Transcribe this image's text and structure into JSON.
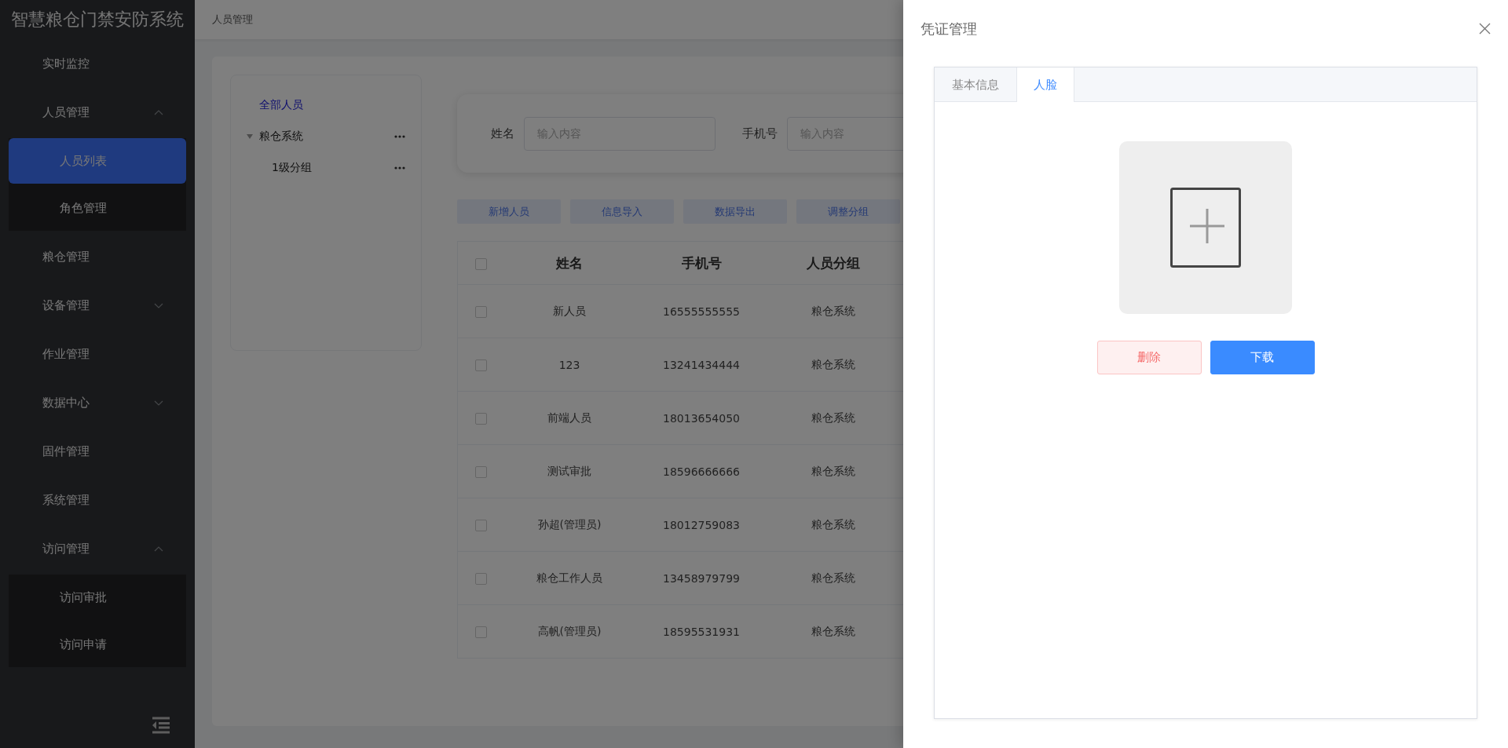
{
  "app_title": "智慧粮仓门禁安防系统",
  "menu": [
    {
      "label": "实时监控"
    },
    {
      "label": "人员管理",
      "expanded": true,
      "children": [
        {
          "label": "人员列表",
          "selected": true
        },
        {
          "label": "角色管理",
          "selected": false
        }
      ]
    },
    {
      "label": "粮仓管理"
    },
    {
      "label": "设备管理",
      "expanded": false
    },
    {
      "label": "作业管理"
    },
    {
      "label": "数据中心",
      "expanded": false
    },
    {
      "label": "固件管理"
    },
    {
      "label": "系统管理"
    },
    {
      "label": "访问管理",
      "expanded": true,
      "children": [
        {
          "label": "访问审批",
          "selected": false
        },
        {
          "label": "访问申请",
          "selected": false
        }
      ]
    }
  ],
  "breadcrumb": "人员管理",
  "tree": [
    {
      "label": "全部人员",
      "selected": true
    },
    {
      "label": "粮仓系统",
      "selected": false,
      "expanded": true,
      "children": [
        {
          "label": "1级分组",
          "selected": false
        }
      ]
    }
  ],
  "search": [
    {
      "label": "姓名",
      "placeholder": "输入内容"
    },
    {
      "label": "手机号",
      "placeholder": "输入内容"
    }
  ],
  "actions": [
    "新增人员",
    "信息导入",
    "数据导出",
    "调整分组"
  ],
  "table": {
    "columns": [
      "姓名",
      "手机号",
      "人员分组"
    ],
    "all_checked": false,
    "rows": [
      {
        "checked": false,
        "cells": [
          "新人员",
          "16555555555",
          "粮仓系统"
        ]
      },
      {
        "checked": false,
        "cells": [
          "123",
          "13241434444",
          "粮仓系统"
        ]
      },
      {
        "checked": false,
        "cells": [
          "前端人员",
          "18013654050",
          "粮仓系统"
        ]
      },
      {
        "checked": false,
        "cells": [
          "测试审批",
          "18596666666",
          "粮仓系统"
        ]
      },
      {
        "checked": false,
        "cells": [
          "孙超(管理员)",
          "18012759083",
          "粮仓系统"
        ]
      },
      {
        "checked": false,
        "cells": [
          "粮仓工作人员",
          "13458979799",
          "粮仓系统"
        ]
      },
      {
        "checked": false,
        "cells": [
          "高帆(管理员)",
          "18595531931",
          "粮仓系统"
        ]
      }
    ]
  },
  "drawer": {
    "title": "凭证管理",
    "tabs": [
      {
        "label": "基本信息",
        "selected": false
      },
      {
        "label": "人脸",
        "selected": true
      }
    ],
    "buttons": [
      {
        "kind": "danger",
        "label": "删除"
      },
      {
        "kind": "primary",
        "label": "下载"
      }
    ]
  }
}
